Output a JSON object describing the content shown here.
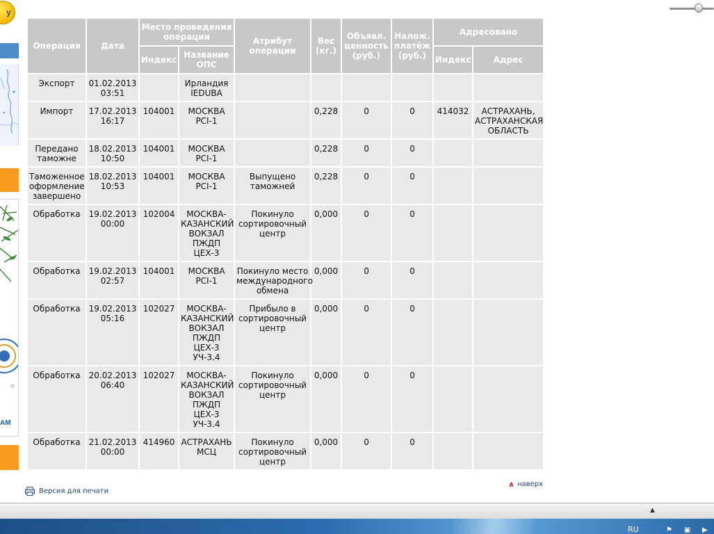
{
  "sidebar": {
    "top_button_label": "у",
    "ad_text": "АМ"
  },
  "table": {
    "headers": {
      "operation": "Операция",
      "date": "Дата",
      "place_group": "Место проведения операции",
      "place_index": "Индекс",
      "place_name": "Название ОПС",
      "attribute": "Атрибут операции",
      "weight": "Вес (кг.)",
      "declared_value": "Объявл. ценность (руб.)",
      "cod": "Налож. платёж (руб.)",
      "addressed_group": "Адресовано",
      "addr_index": "Индекс",
      "address": "Адрес"
    },
    "rows": [
      {
        "operation": "Экспорт",
        "date": "01.02.2013\n03:51",
        "index": "",
        "ops": "Ирландия\nIEDUBA",
        "attribute": "",
        "weight": "",
        "declared": "",
        "cod": "",
        "addr_index": "",
        "address": ""
      },
      {
        "operation": "Импорт",
        "date": "17.02.2013\n16:17",
        "index": "104001",
        "ops": "МОСКВА\nPCI-1",
        "attribute": "",
        "weight": "0,228",
        "declared": "0",
        "cod": "0",
        "addr_index": "414032",
        "address": "АСТРАХАНЬ,\nАСТРАХАНСКАЯ\nОБЛАСТЬ"
      },
      {
        "operation": "Передано\nтаможне",
        "date": "18.02.2013\n10:50",
        "index": "104001",
        "ops": "МОСКВА\nPCI-1",
        "attribute": "",
        "weight": "0,228",
        "declared": "0",
        "cod": "0",
        "addr_index": "",
        "address": ""
      },
      {
        "operation": "Таможенное\nоформление\nзавершено",
        "date": "18.02.2013\n10:53",
        "index": "104001",
        "ops": "МОСКВА\nPCI-1",
        "attribute": "Выпущено\nтаможней",
        "weight": "0,228",
        "declared": "0",
        "cod": "0",
        "addr_index": "",
        "address": ""
      },
      {
        "operation": "Обработка",
        "date": "19.02.2013\n00:00",
        "index": "102004",
        "ops": "МОСКВА-\nКАЗАНСКИЙ\nВОКЗАЛ\nПЖДП\nЦЕХ-3",
        "attribute": "Покинуло\nсортировочный\nцентр",
        "weight": "0,000",
        "declared": "0",
        "cod": "0",
        "addr_index": "",
        "address": ""
      },
      {
        "operation": "Обработка",
        "date": "19.02.2013\n02:57",
        "index": "104001",
        "ops": "МОСКВА\nPCI-1",
        "attribute": "Покинуло место\nмеждународного\nобмена",
        "weight": "0,000",
        "declared": "0",
        "cod": "0",
        "addr_index": "",
        "address": ""
      },
      {
        "operation": "Обработка",
        "date": "19.02.2013\n05:16",
        "index": "102027",
        "ops": "МОСКВА-\nКАЗАНСКИЙ\nВОКЗАЛ\nПЖДП\nЦЕХ-3\nУЧ-3.4",
        "attribute": "Прибыло в\nсортировочный\nцентр",
        "weight": "0,000",
        "declared": "0",
        "cod": "0",
        "addr_index": "",
        "address": ""
      },
      {
        "operation": "Обработка",
        "date": "20.02.2013\n06:40",
        "index": "102027",
        "ops": "МОСКВА-\nКАЗАНСКИЙ\nВОКЗАЛ\nПЖДП\nЦЕХ-3\nУЧ-3.4",
        "attribute": "Покинуло\nсортировочный\nцентр",
        "weight": "0,000",
        "declared": "0",
        "cod": "0",
        "addr_index": "",
        "address": ""
      },
      {
        "operation": "Обработка",
        "date": "21.02.2013\n00:00",
        "index": "414960",
        "ops": "АСТРАХАНЬ\nМСЦ",
        "attribute": "Покинуло\nсортировочный\nцентр",
        "weight": "0,000",
        "declared": "0",
        "cod": "0",
        "addr_index": "",
        "address": ""
      }
    ]
  },
  "footer": {
    "print_label": "Версия для печати",
    "top_label": "наверх"
  },
  "taskbar": {
    "language": "RU"
  },
  "colors": {
    "header_bg": "#c8c8c8",
    "cell_bg": "#e9e9e9",
    "link": "#1a3f7a",
    "accent_orange": "#f79a1d"
  },
  "icons": {
    "print": "printer-icon",
    "up": "chevron-up-icon"
  }
}
